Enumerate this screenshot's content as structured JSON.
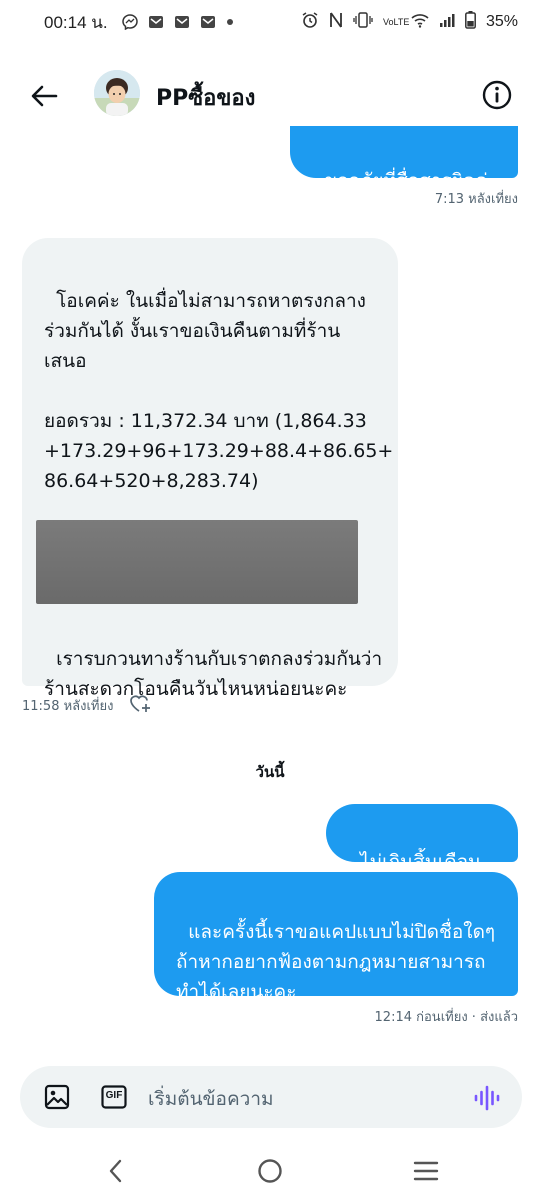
{
  "status_bar": {
    "time": "00:14 น.",
    "battery": "35%",
    "network": "LTE"
  },
  "header": {
    "contact_name": "PPซื้อของ"
  },
  "messages": [
    {
      "type": "sent",
      "text": "ขออภัยที่สื่อสารผิดค่ะ",
      "meta": "7:13 หลังเที่ยง"
    },
    {
      "type": "received",
      "text_top": "โอเคค่ะ ในเมื่อไม่สามารถหาตรงกลาง\nร่วมกันได้ งั้นเราขอเงินคืนตามที่ร้าน\nเสนอ\n\nยอดรวม : 11,372.34 บาท (1,864.33\n+173.29+96+173.29+88.4+86.65+\n86.64+520+8,283.74)\n\nโอนมาที่บัญชี",
      "text_bottom": "เรารบกวนทางร้านกับเราตกลงร่วมกันว่า\nร้านสะดวกโอนคืนวันไหนหน่อยนะคะ",
      "meta": "11:58 หลังเที่ยง"
    },
    {
      "type": "sent",
      "text": "ไม่เกินสิ้นเดือนค่ะ"
    },
    {
      "type": "sent",
      "text": "และครั้งนี้เราขอแคปแบบไม่ปิดชื่อใดๆ\nถ้าหากอยากฟ้องตามกฎหมายสามารถ\nทำได้เลยนะคะ",
      "meta": "12:14 ก่อนเที่ยง · ส่งแล้ว"
    }
  ],
  "day_separator": "วันนี้",
  "composer": {
    "placeholder": "เริ่มต้นข้อความ",
    "gif_label": "GIF"
  },
  "colors": {
    "sent_bubble": "#1d9bf0",
    "received_bubble": "#eff3f4",
    "voice_accent": "#7856ff"
  }
}
